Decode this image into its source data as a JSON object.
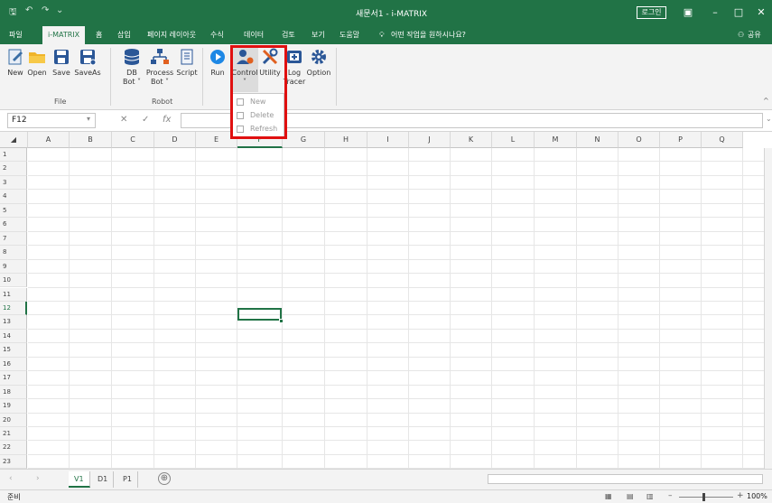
{
  "window": {
    "title": "새문서1 - i-MATRIX",
    "login_label": "로그인",
    "minimize": "–",
    "maximize": "□",
    "close": "✕",
    "ribbon_display": "▣"
  },
  "quick_access": {
    "save": "🖫",
    "undo": "↶",
    "redo": "↷",
    "more": "⌄"
  },
  "tabs": [
    {
      "label": "파일"
    },
    {
      "label": "i-MATRIX"
    },
    {
      "label": "홈"
    },
    {
      "label": "삽입"
    },
    {
      "label": "페이지 레이아웃"
    },
    {
      "label": "수식"
    },
    {
      "label": "데이터"
    },
    {
      "label": "검토"
    },
    {
      "label": "보기"
    },
    {
      "label": "도움말"
    }
  ],
  "tell_me": "어떤 작업을 원하시나요?",
  "share": "공유",
  "ribbon": {
    "file_group": {
      "label": "File",
      "buttons": [
        {
          "label": "New",
          "icon": "new-file-icon"
        },
        {
          "label": "Open",
          "icon": "folder-icon"
        },
        {
          "label": "Save",
          "icon": "save-icon"
        },
        {
          "label": "SaveAs",
          "icon": "save-as-icon"
        }
      ]
    },
    "robot_group": {
      "label": "Robot",
      "buttons": [
        {
          "label": "DB",
          "sub": "Bot ˅",
          "icon": "database-icon"
        },
        {
          "label": "Process",
          "sub": "Bot ˅",
          "icon": "process-icon"
        },
        {
          "label": "Script",
          "icon": "script-icon"
        }
      ]
    },
    "tools": [
      {
        "label": "Run",
        "icon": "run-icon"
      },
      {
        "label": "Control",
        "sub": "˅",
        "icon": "control-icon"
      },
      {
        "label": "Utility",
        "icon": "utility-icon"
      },
      {
        "label": "Log",
        "sub": "Tracer",
        "icon": "log-tracer-icon"
      },
      {
        "label": "Option",
        "icon": "option-icon"
      }
    ],
    "collapse": "^"
  },
  "control_menu": {
    "items": [
      {
        "label": "New"
      },
      {
        "label": "Delete"
      },
      {
        "label": "Refresh"
      }
    ]
  },
  "formula_bar": {
    "name_box": "F12",
    "dropdown": "▾",
    "cancel": "✕",
    "enter": "✓",
    "fx": "fx",
    "value": "",
    "expand": "⌄"
  },
  "columns": [
    "A",
    "B",
    "C",
    "D",
    "E",
    "F",
    "G",
    "H",
    "I",
    "J",
    "K",
    "L",
    "M",
    "N",
    "O",
    "P",
    "Q"
  ],
  "rows": [
    "1",
    "2",
    "3",
    "4",
    "5",
    "6",
    "7",
    "8",
    "9",
    "10",
    "11",
    "12",
    "13",
    "14",
    "15",
    "16",
    "17",
    "18",
    "19",
    "20",
    "21",
    "22",
    "23"
  ],
  "selected": {
    "col": "F",
    "row": "12"
  },
  "sheets": [
    {
      "label": "V1",
      "active": true
    },
    {
      "label": "D1",
      "active": false
    },
    {
      "label": "P1",
      "active": false
    }
  ],
  "add_sheet": "⊕",
  "status": {
    "ready": "준비",
    "zoom": "100%",
    "zoom_minus": "–",
    "zoom_plus": "+"
  },
  "colors": {
    "accent": "#217346",
    "highlight": "#e01010"
  }
}
